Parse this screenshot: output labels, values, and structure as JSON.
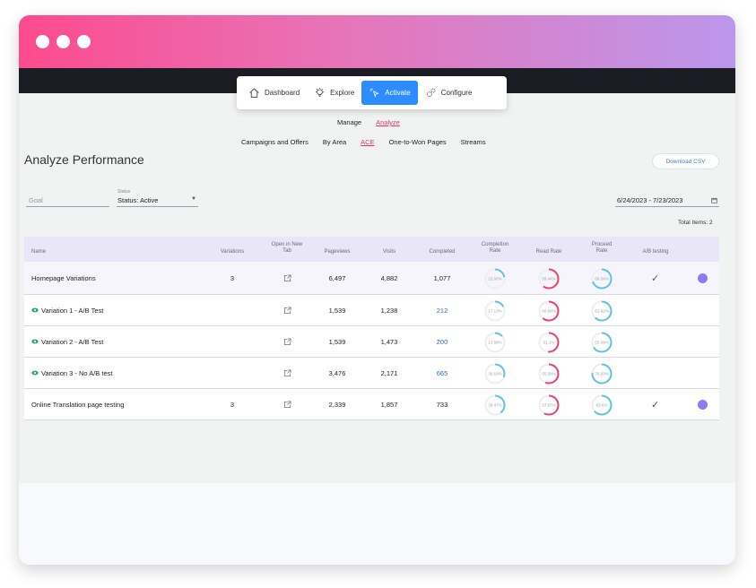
{
  "nav": {
    "items": [
      {
        "label": "Dashboard",
        "icon": "home-icon"
      },
      {
        "label": "Explore",
        "icon": "lightbulb-icon"
      },
      {
        "label": "Activate",
        "icon": "cursor-click-icon"
      },
      {
        "label": "Configure",
        "icon": "gears-icon"
      }
    ],
    "active": "Activate"
  },
  "subnav1": {
    "manage": "Manage",
    "analyze": "Analyze"
  },
  "subnav2": {
    "campaigns": "Campaigns and Offers",
    "by_area": "By Area",
    "ace": "ACE",
    "one_to_won": "One-to-Won Pages",
    "streams": "Streams"
  },
  "page": {
    "title": "Analyze Performance",
    "download": "Download CSV"
  },
  "filters": {
    "goal_placeholder": "Goal",
    "status_label": "Status",
    "status_value": "Status: Active",
    "date_range": "6/24/2023 - 7/23/2023"
  },
  "total_items": "Total Items: 2",
  "columns": {
    "name": "Name",
    "variations": "Variations",
    "open_new_tab_1": "Open in New",
    "open_new_tab_2": "Tab",
    "pageviews": "Pageviews",
    "visits": "Visits",
    "completed": "Completed",
    "completion_rate_1": "Completion",
    "completion_rate_2": "Rate",
    "read_rate": "Read Rate",
    "proceed_rate_1": "Proceed",
    "proceed_rate_2": "Rate",
    "ab_testing": "A/B testing"
  },
  "rows": [
    {
      "name": "Homepage Variations",
      "variations": "3",
      "pageviews": "6,497",
      "visits": "4,882",
      "completed": "1,077",
      "completion_rate": "22.06%",
      "completion_val": 22.06,
      "read_rate": "59.44%",
      "read_val": 59.44,
      "proceed_rate": "69.54%",
      "proceed_val": 69.54,
      "ab": "✓",
      "child": false
    },
    {
      "name": "Variation 1 - A/B Test",
      "variations": "",
      "pageviews": "1,539",
      "visits": "1,238",
      "completed": "212",
      "completion_rate": "17.13%",
      "completion_val": 17.13,
      "read_rate": "60.66%",
      "read_val": 60.66,
      "proceed_rate": "61.92%",
      "proceed_val": 61.92,
      "ab": "",
      "child": true
    },
    {
      "name": "Variation 2 - A/B Test",
      "variations": "",
      "pageviews": "1,539",
      "visits": "1,473",
      "completed": "200",
      "completion_rate": "13.58%",
      "completion_val": 13.58,
      "read_rate": "51.1%",
      "read_val": 51.1,
      "proceed_rate": "65.69%",
      "proceed_val": 65.69,
      "ab": "",
      "child": true
    },
    {
      "name": "Variation 3 - No A/B test",
      "variations": "",
      "pageviews": "3,476",
      "visits": "2,171",
      "completed": "665",
      "completion_rate": "30.63%",
      "completion_val": 30.63,
      "read_rate": "55.58%",
      "read_val": 55.58,
      "proceed_rate": "76.03%",
      "proceed_val": 76.03,
      "ab": "",
      "child": true
    },
    {
      "name": "Online Translation page testing",
      "variations": "3",
      "pageviews": "2,339",
      "visits": "1,857",
      "completed": "733",
      "completion_rate": "39.47%",
      "completion_val": 39.47,
      "read_rate": "57.67%",
      "read_val": 57.67,
      "proceed_rate": "63.6%",
      "proceed_val": 63.6,
      "ab": "✓",
      "child": false
    }
  ],
  "colors": {
    "completion": "#5ec4dd",
    "read": "#ef3f6e",
    "proceed": "#5ec4dd",
    "accent": "#2d8cff",
    "badge": "#8e7bf3"
  }
}
